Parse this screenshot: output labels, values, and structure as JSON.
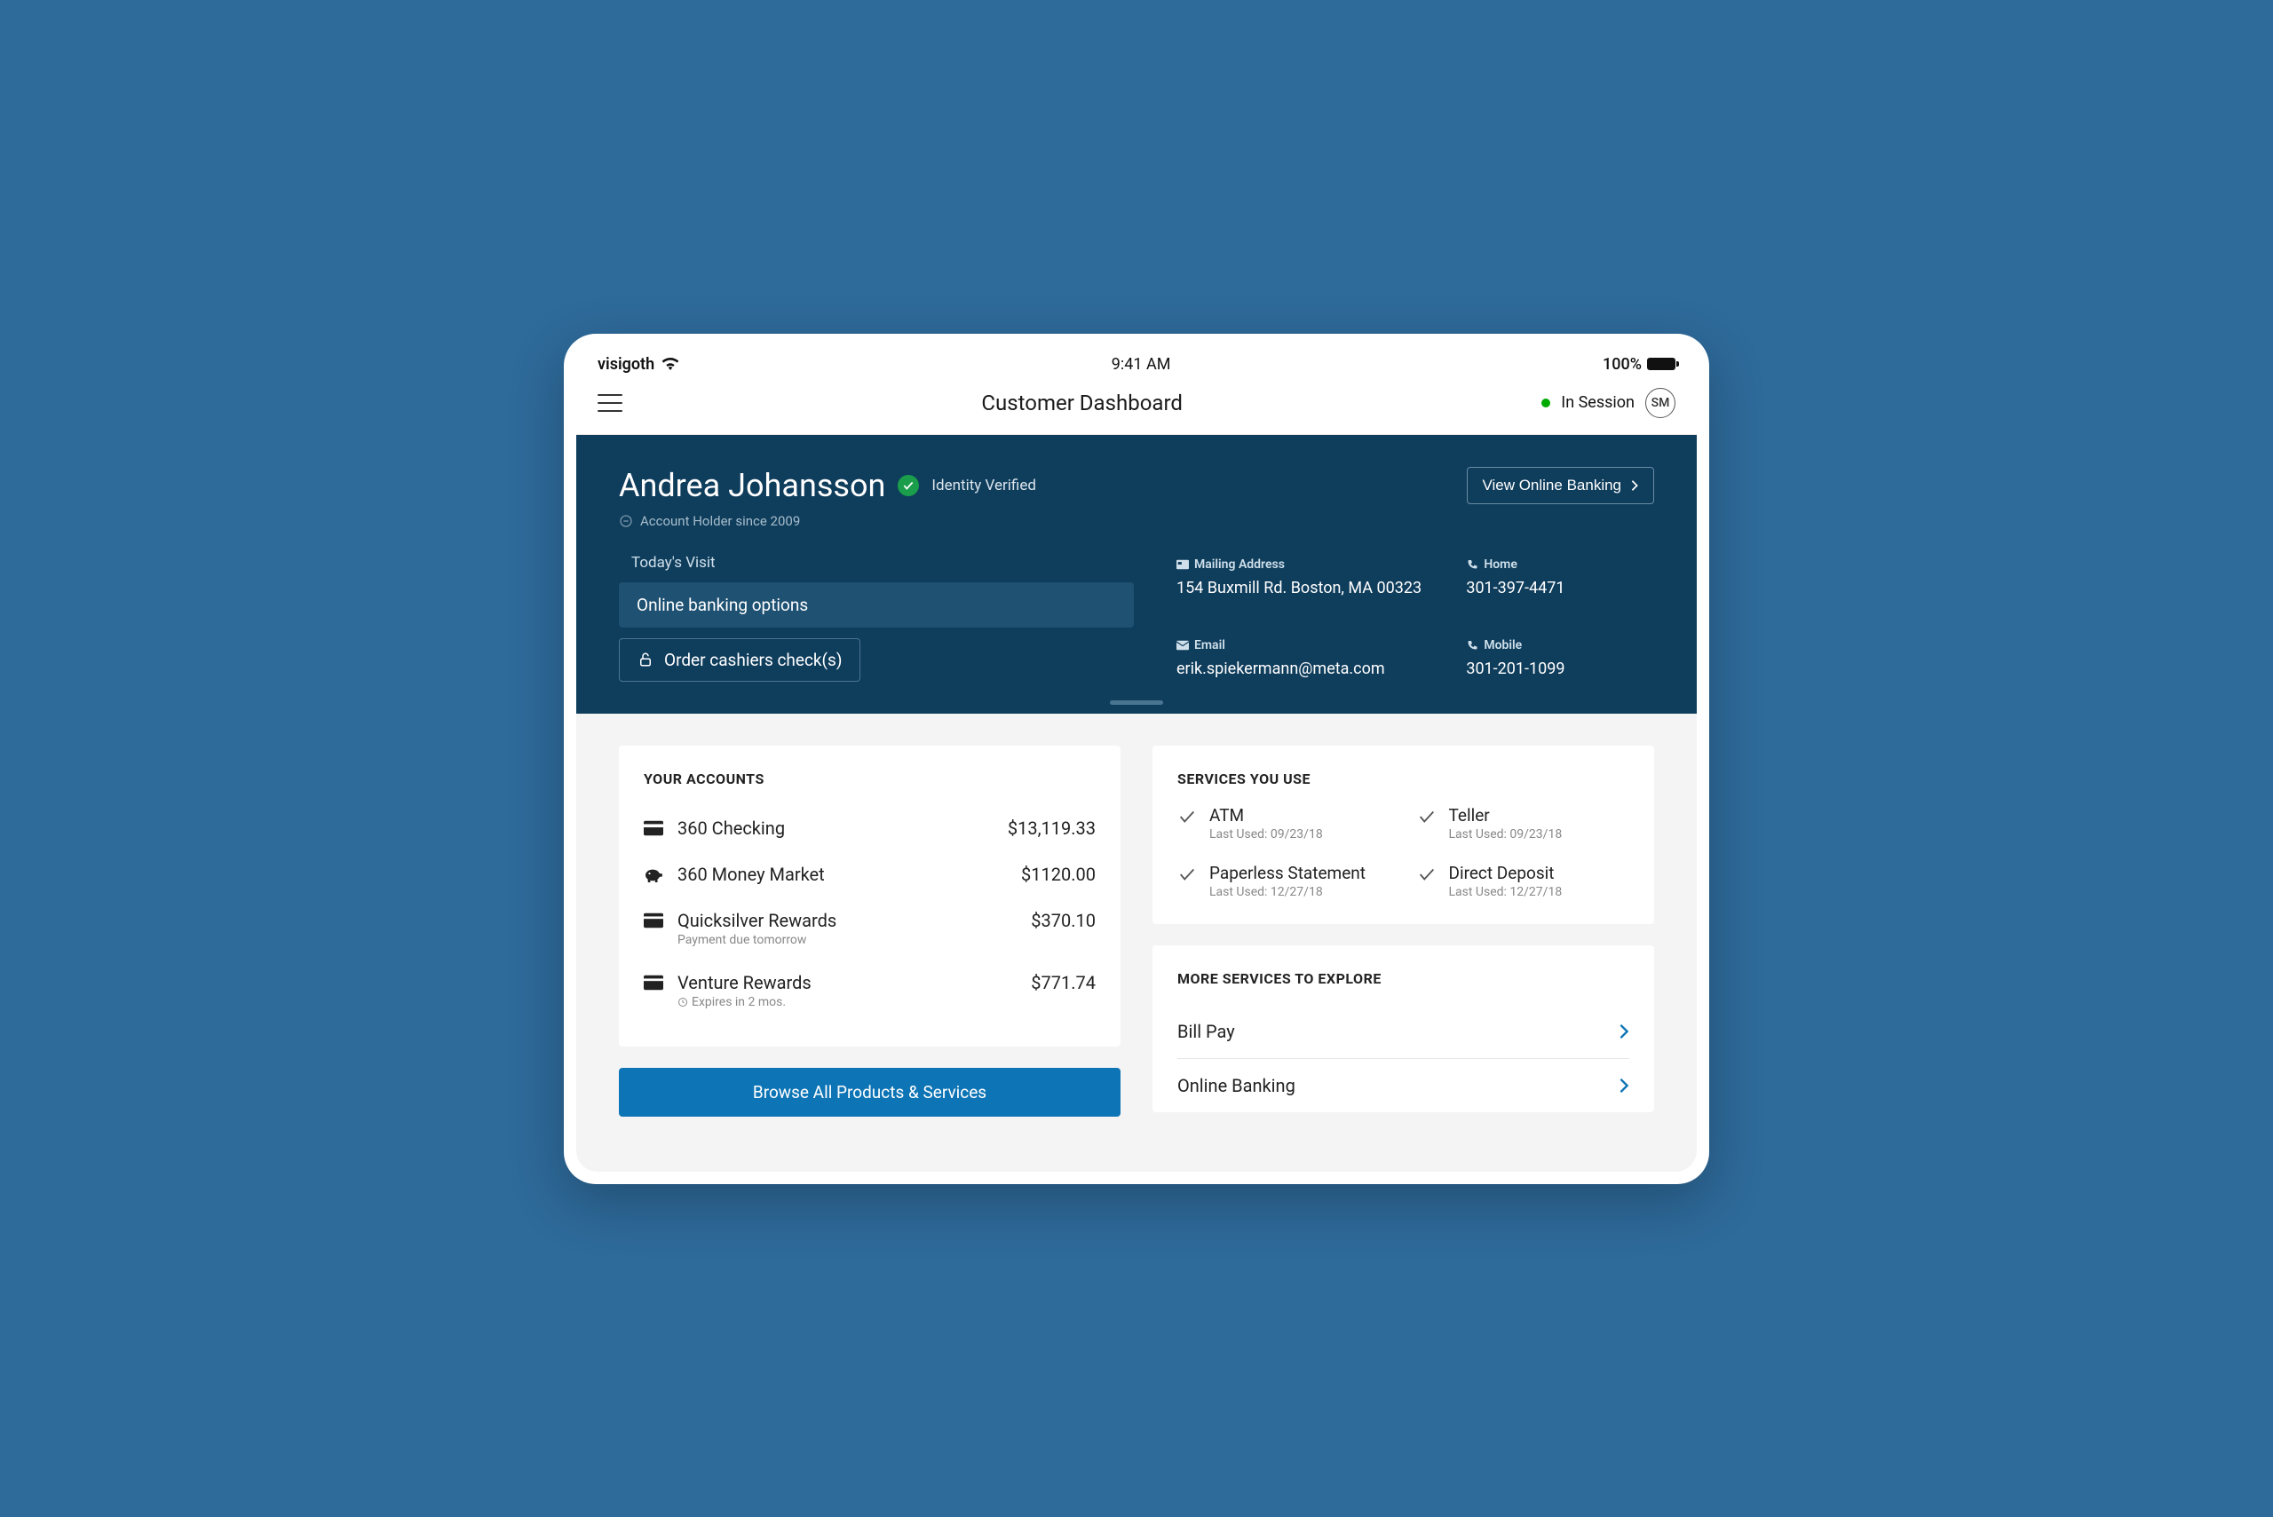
{
  "status_bar": {
    "carrier": "visigoth",
    "time": "9:41 AM",
    "battery_pct": "100%"
  },
  "nav": {
    "title": "Customer Dashboard",
    "session_label": "In Session",
    "avatar_initials": "SM"
  },
  "hero": {
    "customer_name": "Andrea Johansson",
    "verified_label": "Identity Verified",
    "tenure": "Account Holder since 2009",
    "view_banking_label": "View Online Banking",
    "visit_title": "Today's Visit",
    "visit_items": [
      "Online banking options",
      "Order cashiers check(s)"
    ],
    "contacts": {
      "mailing_label": "Mailing Address",
      "mailing_value": "154 Buxmill Rd. Boston, MA 00323",
      "home_label": "Home",
      "home_value": "301-397-4471",
      "email_label": "Email",
      "email_value": "erik.spiekermann@meta.com",
      "mobile_label": "Mobile",
      "mobile_value": "301-201-1099"
    }
  },
  "accounts": {
    "title": "YOUR ACCOUNTS",
    "rows": [
      {
        "name": "360 Checking",
        "sub": "",
        "balance": "$13,119.33"
      },
      {
        "name": "360 Money Market",
        "sub": "",
        "balance": "$1120.00"
      },
      {
        "name": "Quicksilver Rewards",
        "sub": "Payment due tomorrow",
        "balance": "$370.10"
      },
      {
        "name": "Venture Rewards",
        "sub": "Expires in 2 mos.",
        "balance": "$771.74"
      }
    ],
    "browse_label": "Browse All Products & Services"
  },
  "services": {
    "title": "SERVICES YOU USE",
    "items": [
      {
        "name": "ATM",
        "sub": "Last Used: 09/23/18"
      },
      {
        "name": "Teller",
        "sub": "Last Used: 09/23/18"
      },
      {
        "name": "Paperless Statement",
        "sub": "Last Used: 12/27/18"
      },
      {
        "name": "Direct Deposit",
        "sub": "Last Used: 12/27/18"
      }
    ]
  },
  "explore": {
    "title": "MORE SERVICES TO EXPLORE",
    "items": [
      "Bill Pay",
      "Online Banking"
    ]
  }
}
